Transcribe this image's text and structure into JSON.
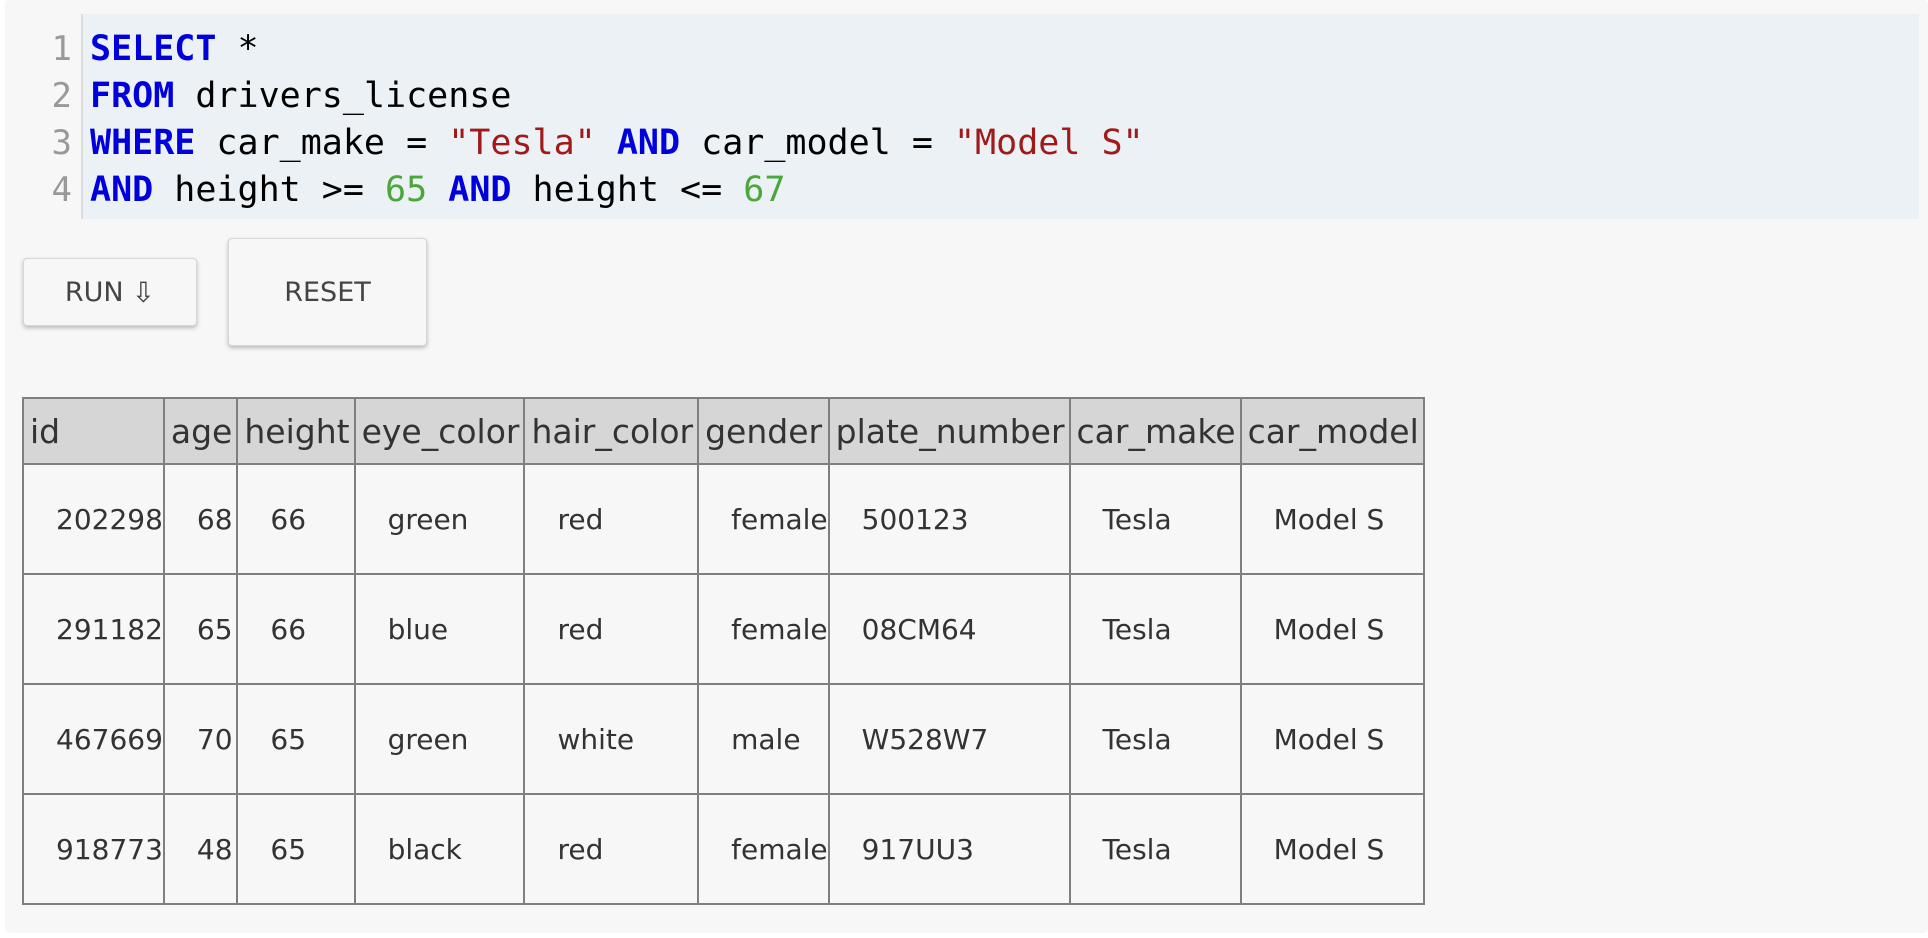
{
  "editor": {
    "line_numbers": [
      "1",
      "2",
      "3",
      "4"
    ],
    "lines": [
      [
        {
          "text": "SELECT",
          "kind": "kw"
        },
        {
          "text": " *",
          "kind": "plain"
        }
      ],
      [
        {
          "text": "FROM",
          "kind": "kw"
        },
        {
          "text": " drivers_license",
          "kind": "plain"
        }
      ],
      [
        {
          "text": "WHERE",
          "kind": "kw"
        },
        {
          "text": " car_make = ",
          "kind": "plain"
        },
        {
          "text": "\"Tesla\"",
          "kind": "str"
        },
        {
          "text": " ",
          "kind": "plain"
        },
        {
          "text": "AND",
          "kind": "kw"
        },
        {
          "text": " car_model = ",
          "kind": "plain"
        },
        {
          "text": "\"Model S\"",
          "kind": "str"
        }
      ],
      [
        {
          "text": "AND",
          "kind": "kw"
        },
        {
          "text": " height >= ",
          "kind": "plain"
        },
        {
          "text": "65",
          "kind": "num"
        },
        {
          "text": " ",
          "kind": "plain"
        },
        {
          "text": "AND",
          "kind": "kw"
        },
        {
          "text": " height <= ",
          "kind": "plain"
        },
        {
          "text": "67",
          "kind": "num"
        }
      ]
    ]
  },
  "buttons": {
    "run_label": "RUN",
    "run_icon": "arrow-down-icon",
    "run_icon_glyph": "⇩",
    "reset_label": "RESET"
  },
  "results": {
    "columns": [
      "id",
      "age",
      "height",
      "eye_color",
      "hair_color",
      "gender",
      "plate_number",
      "car_make",
      "car_model"
    ],
    "rows": [
      [
        "202298",
        "68",
        "66",
        "green",
        "red",
        "female",
        "500123",
        "Tesla",
        "Model S"
      ],
      [
        "291182",
        "65",
        "66",
        "blue",
        "red",
        "female",
        "08CM64",
        "Tesla",
        "Model S"
      ],
      [
        "467669",
        "70",
        "65",
        "green",
        "white",
        "male",
        "W528W7",
        "Tesla",
        "Model S"
      ],
      [
        "918773",
        "48",
        "65",
        "black",
        "red",
        "female",
        "917UU3",
        "Tesla",
        "Model S"
      ]
    ]
  },
  "colors": {
    "keyword": "#0000dd",
    "string": "#a11a1a",
    "number": "#4aa73c",
    "editor_bg": "#ebf1f5",
    "header_bg": "#d6d6d6"
  }
}
